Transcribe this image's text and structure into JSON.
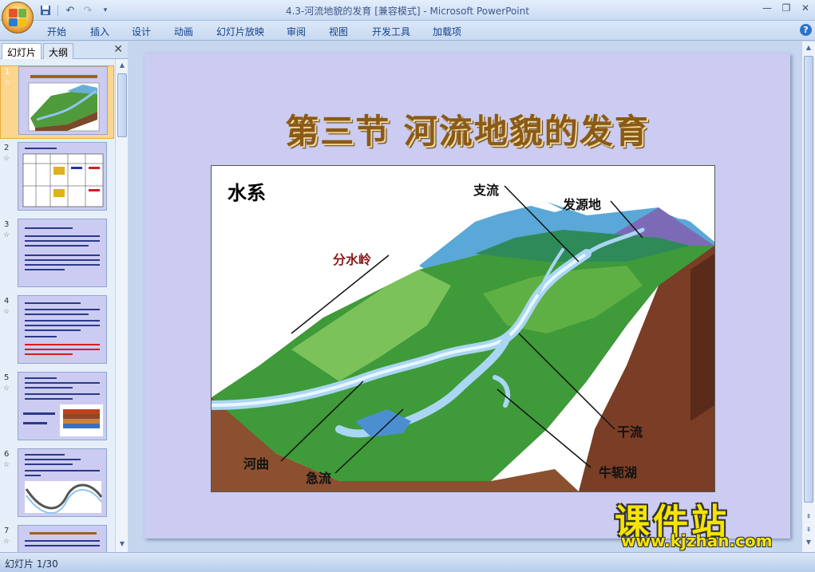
{
  "window": {
    "title": "4.3-河流地貌的发育 [兼容模式] - Microsoft PowerPoint",
    "controls": [
      "minimize",
      "restore",
      "close"
    ]
  },
  "qat": {
    "icons": [
      "save-icon",
      "undo-icon",
      "redo-icon",
      "customize-icon"
    ]
  },
  "ribbon": {
    "tabs": [
      "开始",
      "插入",
      "设计",
      "动画",
      "幻灯片放映",
      "审阅",
      "视图",
      "开发工具",
      "加载项"
    ]
  },
  "left_pane": {
    "tab_slides": "幻灯片",
    "tab_outline": "大纲",
    "close_glyph": "✕",
    "thumbnails": [
      {
        "num": "1",
        "star": "☆",
        "selected": true
      },
      {
        "num": "2",
        "star": "☆",
        "selected": false
      },
      {
        "num": "3",
        "star": "☆",
        "selected": false
      },
      {
        "num": "4",
        "star": "☆",
        "selected": false
      },
      {
        "num": "5",
        "star": "☆",
        "selected": false
      },
      {
        "num": "6",
        "star": "☆",
        "selected": false
      },
      {
        "num": "7",
        "star": "☆",
        "selected": false
      }
    ]
  },
  "slide": {
    "title": "第三节  河流地貌的发育",
    "figure_title": "水系",
    "labels": {
      "tributary": "支流",
      "source": "发源地",
      "watershed": "分水岭",
      "mainstream": "干流",
      "meander": "河曲",
      "rapids": "急流",
      "oxbow": "牛轭湖"
    }
  },
  "status": {
    "slide_counter": "幻灯片 1/30"
  },
  "watermark": {
    "brand": "课件站",
    "url": "www.kjzhan.com"
  },
  "colors": {
    "title_brown": "#8a5a16",
    "slide_bg": "#ccccf2",
    "watermark_yellow": "#f5e400",
    "label_red": "#8a1a1a"
  }
}
